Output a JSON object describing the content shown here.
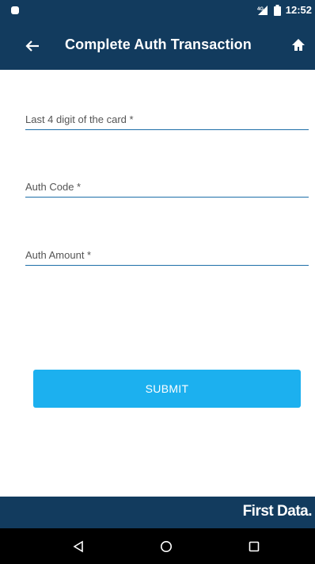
{
  "status_bar": {
    "time": "12:52"
  },
  "app_bar": {
    "title": "Complete Auth Transaction",
    "back_icon": "arrow-left-icon",
    "home_icon": "home-icon"
  },
  "form": {
    "fields": [
      {
        "placeholder": "Last 4 digit of the card *",
        "value": ""
      },
      {
        "placeholder": "Auth Code *",
        "value": ""
      },
      {
        "placeholder": "Auth Amount *",
        "value": ""
      }
    ],
    "submit_label": "SUBMIT"
  },
  "footer": {
    "brand": "First Data."
  },
  "colors": {
    "primary": "#123b5e",
    "accent": "#1cb0ef",
    "underline": "#1e6fa8"
  }
}
